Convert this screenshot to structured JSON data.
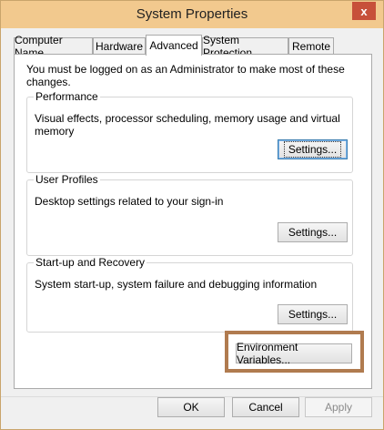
{
  "window": {
    "title": "System Properties",
    "close_label": "x"
  },
  "tabs": [
    {
      "label": "Computer Name"
    },
    {
      "label": "Hardware"
    },
    {
      "label": "Advanced"
    },
    {
      "label": "System Protection"
    },
    {
      "label": "Remote"
    }
  ],
  "notice": "You must be logged on as an Administrator to make most of these changes.",
  "groups": {
    "performance": {
      "label": "Performance",
      "description": "Visual effects, processor scheduling, memory usage and virtual memory",
      "button": "Settings..."
    },
    "user_profiles": {
      "label": "User Profiles",
      "description": "Desktop settings related to your sign-in",
      "button": "Settings..."
    },
    "startup": {
      "label": "Start-up and Recovery",
      "description": "System start-up, system failure and debugging information",
      "button": "Settings..."
    }
  },
  "environment_button": "Environment Variables...",
  "footer": {
    "ok": "OK",
    "cancel": "Cancel",
    "apply": "Apply"
  },
  "colors": {
    "titlebar": "#f2c98e",
    "close": "#c7503a",
    "highlight": "#b07b4f"
  }
}
